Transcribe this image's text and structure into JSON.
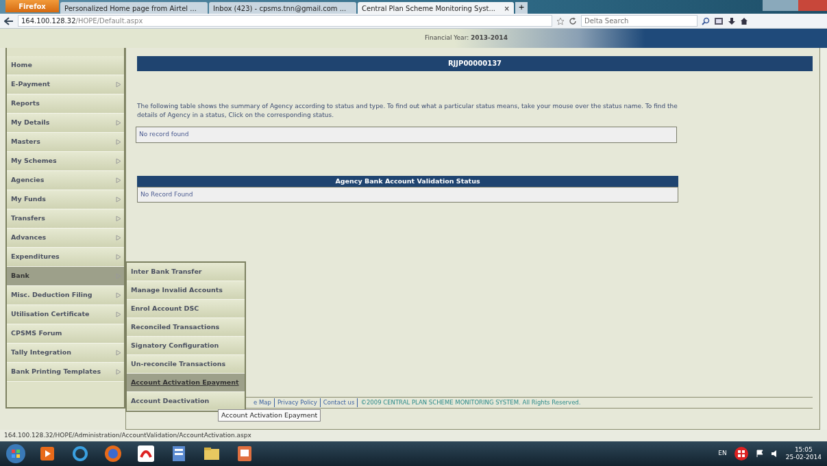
{
  "browser": {
    "menu_button": "Firefox",
    "tabs": [
      {
        "label": "Personalized Home page from Airtel ...",
        "selected": false
      },
      {
        "label": "Inbox (423) - cpsms.tnn@gmail.com ...",
        "selected": false
      },
      {
        "label": "Central Plan Scheme Monitoring Syst...",
        "selected": true
      }
    ],
    "new_tab": "+",
    "close_tab": "×",
    "address": {
      "host": "164.100.128.32",
      "path": "/HOPE/Default.aspx"
    },
    "search": {
      "placeholder": "Delta Search"
    },
    "status_url": "164.100.128.32/HOPE/Administration/AccountValidation/AccountActivation.aspx"
  },
  "header": {
    "financial_year_label": "Financial Year:",
    "financial_year": "2013-2014"
  },
  "sidebar": {
    "items": [
      {
        "label": "Home",
        "has_submenu": false,
        "selected": false
      },
      {
        "label": "E-Payment",
        "has_submenu": true,
        "selected": false
      },
      {
        "label": "Reports",
        "has_submenu": false,
        "selected": false
      },
      {
        "label": "My Details",
        "has_submenu": true,
        "selected": false
      },
      {
        "label": "Masters",
        "has_submenu": true,
        "selected": false
      },
      {
        "label": "My Schemes",
        "has_submenu": true,
        "selected": false
      },
      {
        "label": "Agencies",
        "has_submenu": true,
        "selected": false
      },
      {
        "label": "My Funds",
        "has_submenu": true,
        "selected": false
      },
      {
        "label": "Transfers",
        "has_submenu": true,
        "selected": false
      },
      {
        "label": "Advances",
        "has_submenu": true,
        "selected": false
      },
      {
        "label": "Expenditures",
        "has_submenu": true,
        "selected": false
      },
      {
        "label": "Bank",
        "has_submenu": true,
        "selected": true
      },
      {
        "label": "Misc. Deduction Filing",
        "has_submenu": true,
        "selected": false
      },
      {
        "label": "Utilisation Certificate",
        "has_submenu": true,
        "selected": false
      },
      {
        "label": "CPSMS Forum",
        "has_submenu": false,
        "selected": false
      },
      {
        "label": "Tally Integration",
        "has_submenu": true,
        "selected": false
      },
      {
        "label": "Bank Printing Templates",
        "has_submenu": true,
        "selected": false
      }
    ]
  },
  "submenu": {
    "items": [
      {
        "label": "Inter Bank Transfer",
        "selected": false
      },
      {
        "label": "Manage Invalid Accounts",
        "selected": false
      },
      {
        "label": "Enrol Account DSC",
        "selected": false
      },
      {
        "label": "Reconciled Transactions",
        "selected": false
      },
      {
        "label": "Signatory Configuration",
        "selected": false
      },
      {
        "label": "Un-reconcile Transactions",
        "selected": false
      },
      {
        "label": "Account Activation Epayment",
        "selected": true
      },
      {
        "label": "Account Deactivation",
        "selected": false
      }
    ]
  },
  "main": {
    "title": "RJJP00000137",
    "intro": "The following table shows the summary of Agency according to status and type. To find out what a particular status means, take your mouse over the status name. To find the details of Agency in a status, Click on the corresponding status.",
    "summary_empty": "No record found",
    "validation_title": "Agency Bank Account Validation Status",
    "validation_empty": "No Record Found"
  },
  "footer": {
    "links": [
      "e Map",
      "Privacy Policy",
      "Contact us"
    ],
    "copyright": "©2009 CENTRAL PLAN SCHEME MONITORING SYSTEM. All Rights Reserved."
  },
  "tooltip": "Account Activation Epayment",
  "taskbar": {
    "language": "EN",
    "time": "15:05",
    "date": "25-02-2014"
  }
}
